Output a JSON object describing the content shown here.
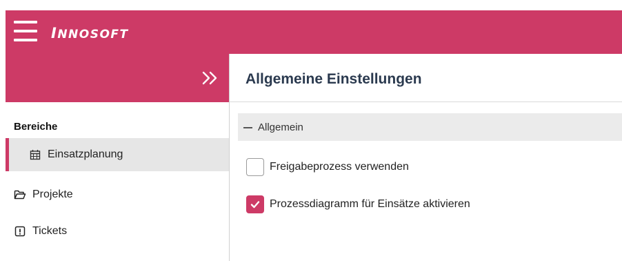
{
  "app": {
    "logo_text": "INNOSOFT"
  },
  "header": {
    "menu_icon": "hamburger-icon"
  },
  "sidebar": {
    "collapse_icon": "double-chevron-right-icon",
    "section_label": "Bereiche",
    "items": [
      {
        "label": "Einsatzplanung",
        "icon": "calendar-icon",
        "active": true
      },
      {
        "label": "Projekte",
        "icon": "folder-open-icon",
        "active": false
      },
      {
        "label": "Tickets",
        "icon": "alert-box-icon",
        "active": false
      }
    ]
  },
  "main": {
    "title": "Allgemeine Einstellungen",
    "group": {
      "label": "Allgemein",
      "expanded": true,
      "toggle_icon": "minus-icon"
    },
    "settings": [
      {
        "label": "Freigabeprozess verwenden",
        "checked": false
      },
      {
        "label": "Prozessdiagramm für Einsätze aktivieren",
        "checked": true
      }
    ]
  },
  "colors": {
    "accent": "#cd3a66",
    "title": "#2b3a4f",
    "active_bg": "#e6e6e6",
    "group_bg": "#ebebeb"
  }
}
